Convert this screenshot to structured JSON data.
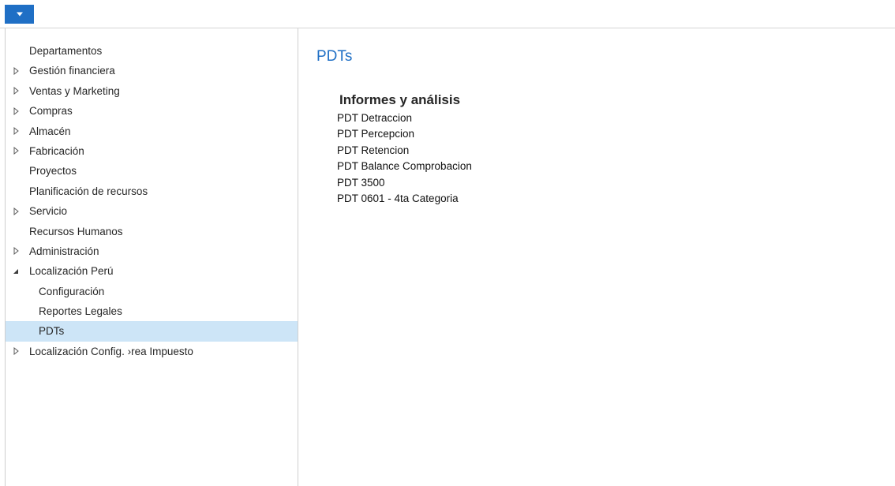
{
  "topbar": {
    "menu_icon": "chevron-down-icon",
    "accent_color": "#1f6fc5"
  },
  "sidebar": {
    "items": [
      {
        "label": "Departamentos",
        "expander": "none",
        "indent": 0,
        "selected": false
      },
      {
        "label": "Gestión financiera",
        "expander": "collapsed",
        "indent": 0,
        "selected": false
      },
      {
        "label": "Ventas y Marketing",
        "expander": "collapsed",
        "indent": 0,
        "selected": false
      },
      {
        "label": "Compras",
        "expander": "collapsed",
        "indent": 0,
        "selected": false
      },
      {
        "label": "Almacén",
        "expander": "collapsed",
        "indent": 0,
        "selected": false
      },
      {
        "label": "Fabricación",
        "expander": "collapsed",
        "indent": 0,
        "selected": false
      },
      {
        "label": "Proyectos",
        "expander": "none",
        "indent": 0,
        "selected": false
      },
      {
        "label": "Planificación de recursos",
        "expander": "none",
        "indent": 0,
        "selected": false
      },
      {
        "label": "Servicio",
        "expander": "collapsed",
        "indent": 0,
        "selected": false
      },
      {
        "label": "Recursos Humanos",
        "expander": "none",
        "indent": 0,
        "selected": false
      },
      {
        "label": "Administración",
        "expander": "collapsed",
        "indent": 0,
        "selected": false
      },
      {
        "label": "Localización Perú",
        "expander": "expanded",
        "indent": 0,
        "selected": false
      },
      {
        "label": "Configuración",
        "expander": "none",
        "indent": 1,
        "selected": false
      },
      {
        "label": "Reportes Legales",
        "expander": "none",
        "indent": 1,
        "selected": false
      },
      {
        "label": "PDTs",
        "expander": "none",
        "indent": 1,
        "selected": true
      },
      {
        "label": "Localización Config. ›rea Impuesto",
        "expander": "collapsed",
        "indent": 0,
        "selected": false
      }
    ],
    "selected_color": "#cde5f7"
  },
  "main": {
    "title": "PDTs",
    "section": {
      "heading": "Informes y análisis",
      "links": [
        "PDT Detraccion",
        "PDT Percepcion",
        "PDT Retencion",
        "PDT Balance Comprobacion",
        "PDT 3500",
        "PDT 0601 - 4ta Categoria"
      ]
    }
  }
}
